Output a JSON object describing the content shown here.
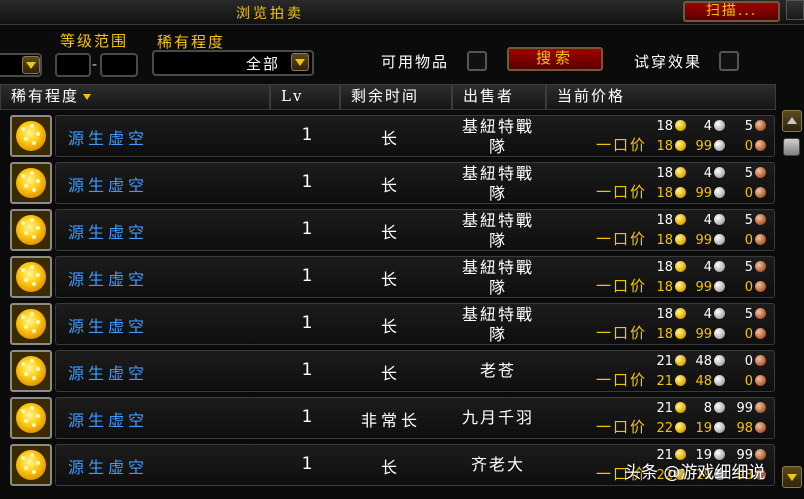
{
  "window": {
    "title": "浏览拍卖",
    "scan_label": "扫描..."
  },
  "filters": {
    "level_range_label": "等级范围",
    "level_min": "",
    "level_max": "",
    "level_separator": "-",
    "rarity_label": "稀有程度",
    "rarity_value": "全部",
    "usable_label": "可用物品",
    "usable_checked": false,
    "search_label": "搜索",
    "preview_label": "试穿效果",
    "preview_checked": false
  },
  "columns": {
    "rarity": "稀有程度",
    "level": "Lv",
    "time_left": "剩余时间",
    "seller": "出售者",
    "current_price": "当前价格"
  },
  "buyout_label": "一口价",
  "rows": [
    {
      "name": "源生虚空",
      "level": "1",
      "time": "长",
      "seller": "基紐特戰隊",
      "bid": {
        "g": "18",
        "s": "4",
        "c": "5"
      },
      "buyout": {
        "g": "18",
        "s": "99",
        "c": "0"
      }
    },
    {
      "name": "源生虚空",
      "level": "1",
      "time": "长",
      "seller": "基紐特戰隊",
      "bid": {
        "g": "18",
        "s": "4",
        "c": "5"
      },
      "buyout": {
        "g": "18",
        "s": "99",
        "c": "0"
      }
    },
    {
      "name": "源生虚空",
      "level": "1",
      "time": "长",
      "seller": "基紐特戰隊",
      "bid": {
        "g": "18",
        "s": "4",
        "c": "5"
      },
      "buyout": {
        "g": "18",
        "s": "99",
        "c": "0"
      }
    },
    {
      "name": "源生虚空",
      "level": "1",
      "time": "长",
      "seller": "基紐特戰隊",
      "bid": {
        "g": "18",
        "s": "4",
        "c": "5"
      },
      "buyout": {
        "g": "18",
        "s": "99",
        "c": "0"
      }
    },
    {
      "name": "源生虚空",
      "level": "1",
      "time": "长",
      "seller": "基紐特戰隊",
      "bid": {
        "g": "18",
        "s": "4",
        "c": "5"
      },
      "buyout": {
        "g": "18",
        "s": "99",
        "c": "0"
      }
    },
    {
      "name": "源生虚空",
      "level": "1",
      "time": "长",
      "seller": "老苍",
      "bid": {
        "g": "21",
        "s": "48",
        "c": "0"
      },
      "buyout": {
        "g": "21",
        "s": "48",
        "c": "0"
      }
    },
    {
      "name": "源生虚空",
      "level": "1",
      "time": "非常长",
      "seller": "九月千羽",
      "bid": {
        "g": "21",
        "s": "8",
        "c": "99"
      },
      "buyout": {
        "g": "22",
        "s": "19",
        "c": "98"
      }
    },
    {
      "name": "源生虚空",
      "level": "1",
      "time": "长",
      "seller": "齐老大",
      "bid": {
        "g": "21",
        "s": "19",
        "c": "99"
      },
      "buyout": {
        "g": "22",
        "s": "19",
        "c": "98"
      }
    }
  ],
  "watermark": "头条 @游戏细细说",
  "colors": {
    "gold_text": "#f5c400",
    "item_blue": "#3d9bff",
    "button_red": "#a10000"
  }
}
